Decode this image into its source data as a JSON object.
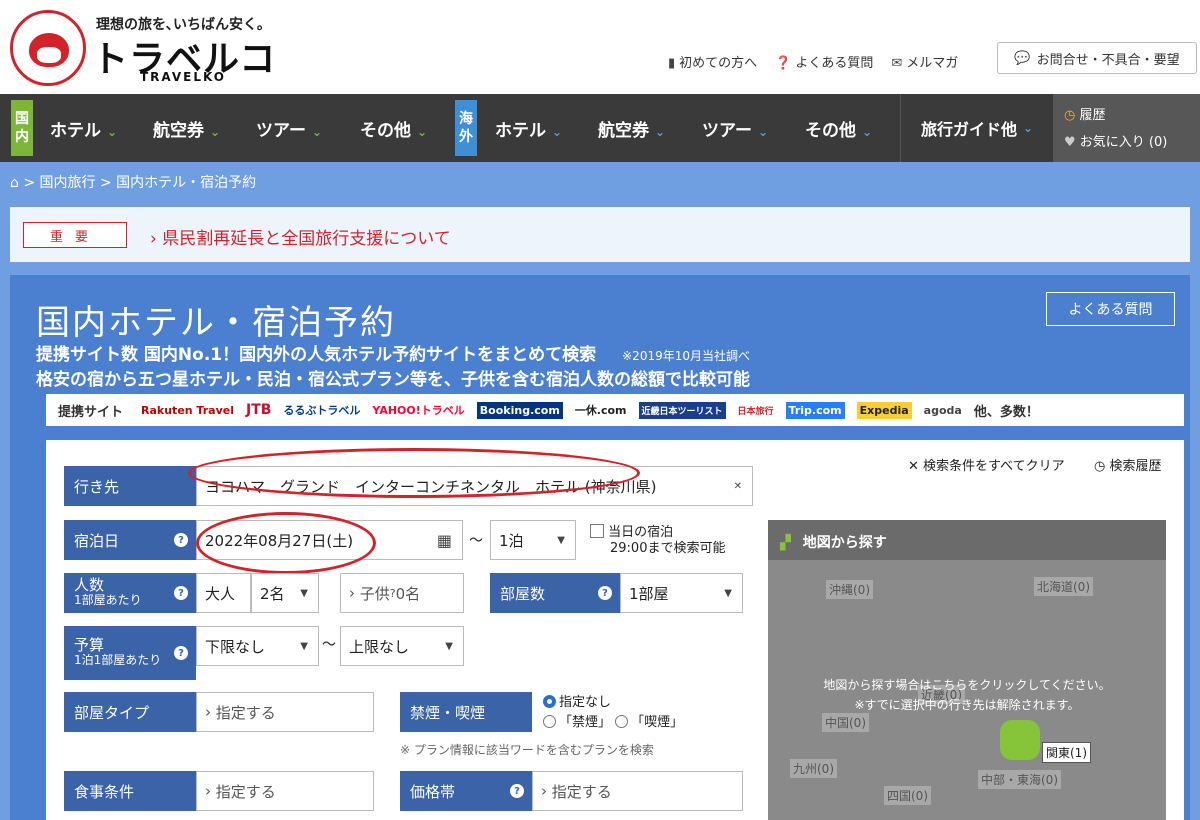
{
  "header": {
    "tagline": "理想の旅を､いちばん安く｡",
    "brand": "トラベルコ",
    "brand_en": "TRAVELKO",
    "links": [
      {
        "icon": "guide-icon",
        "label": "初めての方へ"
      },
      {
        "icon": "question-icon",
        "label": "よくある質問"
      },
      {
        "icon": "mail-icon",
        "label": "メルマガ"
      }
    ],
    "contact_label": "お問合せ・不具合・要望"
  },
  "nav": {
    "domestic_label": "国内",
    "international_label": "海外",
    "domestic_items": [
      "ホテル",
      "航空券",
      "ツアー",
      "その他"
    ],
    "international_items": [
      "ホテル",
      "航空券",
      "ツアー",
      "その他"
    ],
    "guide_label": "旅行ガイド他",
    "history_label": "履歴",
    "favorites_label": "お気に入り (0)"
  },
  "breadcrumb": {
    "home_icon": "home-icon",
    "items": [
      "国内旅行",
      "国内ホテル・宿泊予約"
    ]
  },
  "notice": {
    "tag": "重要",
    "message": "県民割再延長と全国旅行支援について"
  },
  "main": {
    "title": "国内ホテル・宿泊予約",
    "faq_label": "よくある質問",
    "subtitle1": "提携サイト数 国内No.1！国内外の人気ホテル予約サイトをまとめて検索",
    "subtitle1_note": "※2019年10月当社調べ",
    "subtitle2": "格安の宿から五つ星ホテル・民泊・宿公式プラン等を、子供を含む宿泊人数の総額で比較可能",
    "partners_label": "提携サイト",
    "partners": [
      "Rakuten Travel",
      "JTB",
      "るるぶトラベル",
      "YAHOO!トラベル",
      "Booking.com",
      "一休.com",
      "近畿日本ツーリスト",
      "日本旅行",
      "Trip.com",
      "Expedia",
      "agoda"
    ],
    "partners_more": "他、多数！"
  },
  "form": {
    "clear_label": "検索条件をすべてクリア",
    "history_label": "検索履歴",
    "destination_label": "行き先",
    "destination_value": "ヨコハマ　グランド　インターコンチネンタル　ホテル (神奈川県)",
    "date_label": "宿泊日",
    "date_value": "2022年08月27日(土)",
    "nights_value": "1泊",
    "sameday_label1": "当日の宿泊",
    "sameday_label2": "29:00まで検索可能",
    "people_label": "人数",
    "people_sub": "1部屋あたり",
    "adult_label": "大人",
    "adult_value": "2名",
    "child_label": "子供",
    "child_value": "0名",
    "rooms_label": "部屋数",
    "rooms_value": "1部屋",
    "budget_label": "予算",
    "budget_sub": "1泊1部屋あたり",
    "budget_min": "下限なし",
    "budget_max": "上限なし",
    "roomtype_label": "部屋タイプ",
    "specify": "指定する",
    "smoking_label": "禁煙・喫煙",
    "smoking_options": [
      "指定なし",
      "「禁煙」",
      "「喫煙」"
    ],
    "smoking_note": "※ プラン情報に該当ワードを含むプランを検索",
    "meal_label": "食事条件",
    "price_label": "価格帯"
  },
  "map": {
    "title": "地図から探す",
    "message1": "地図から探す場合はこちらをクリックしてください。",
    "message2": "※すでに選択中の行き先は解除されます。",
    "regions": [
      "沖縄(0)",
      "北海道(0)",
      "中国(0)",
      "九州(0)",
      "近畿(0)",
      "関東(1)",
      "四国(0)",
      "中部・東海(0)"
    ]
  },
  "colors": {
    "brand_red": "#d2232a",
    "nav_dark": "#3a3a3a",
    "domestic_green": "#7bb83a",
    "intl_blue": "#3d8fd8",
    "label_blue": "#3a63a8"
  }
}
